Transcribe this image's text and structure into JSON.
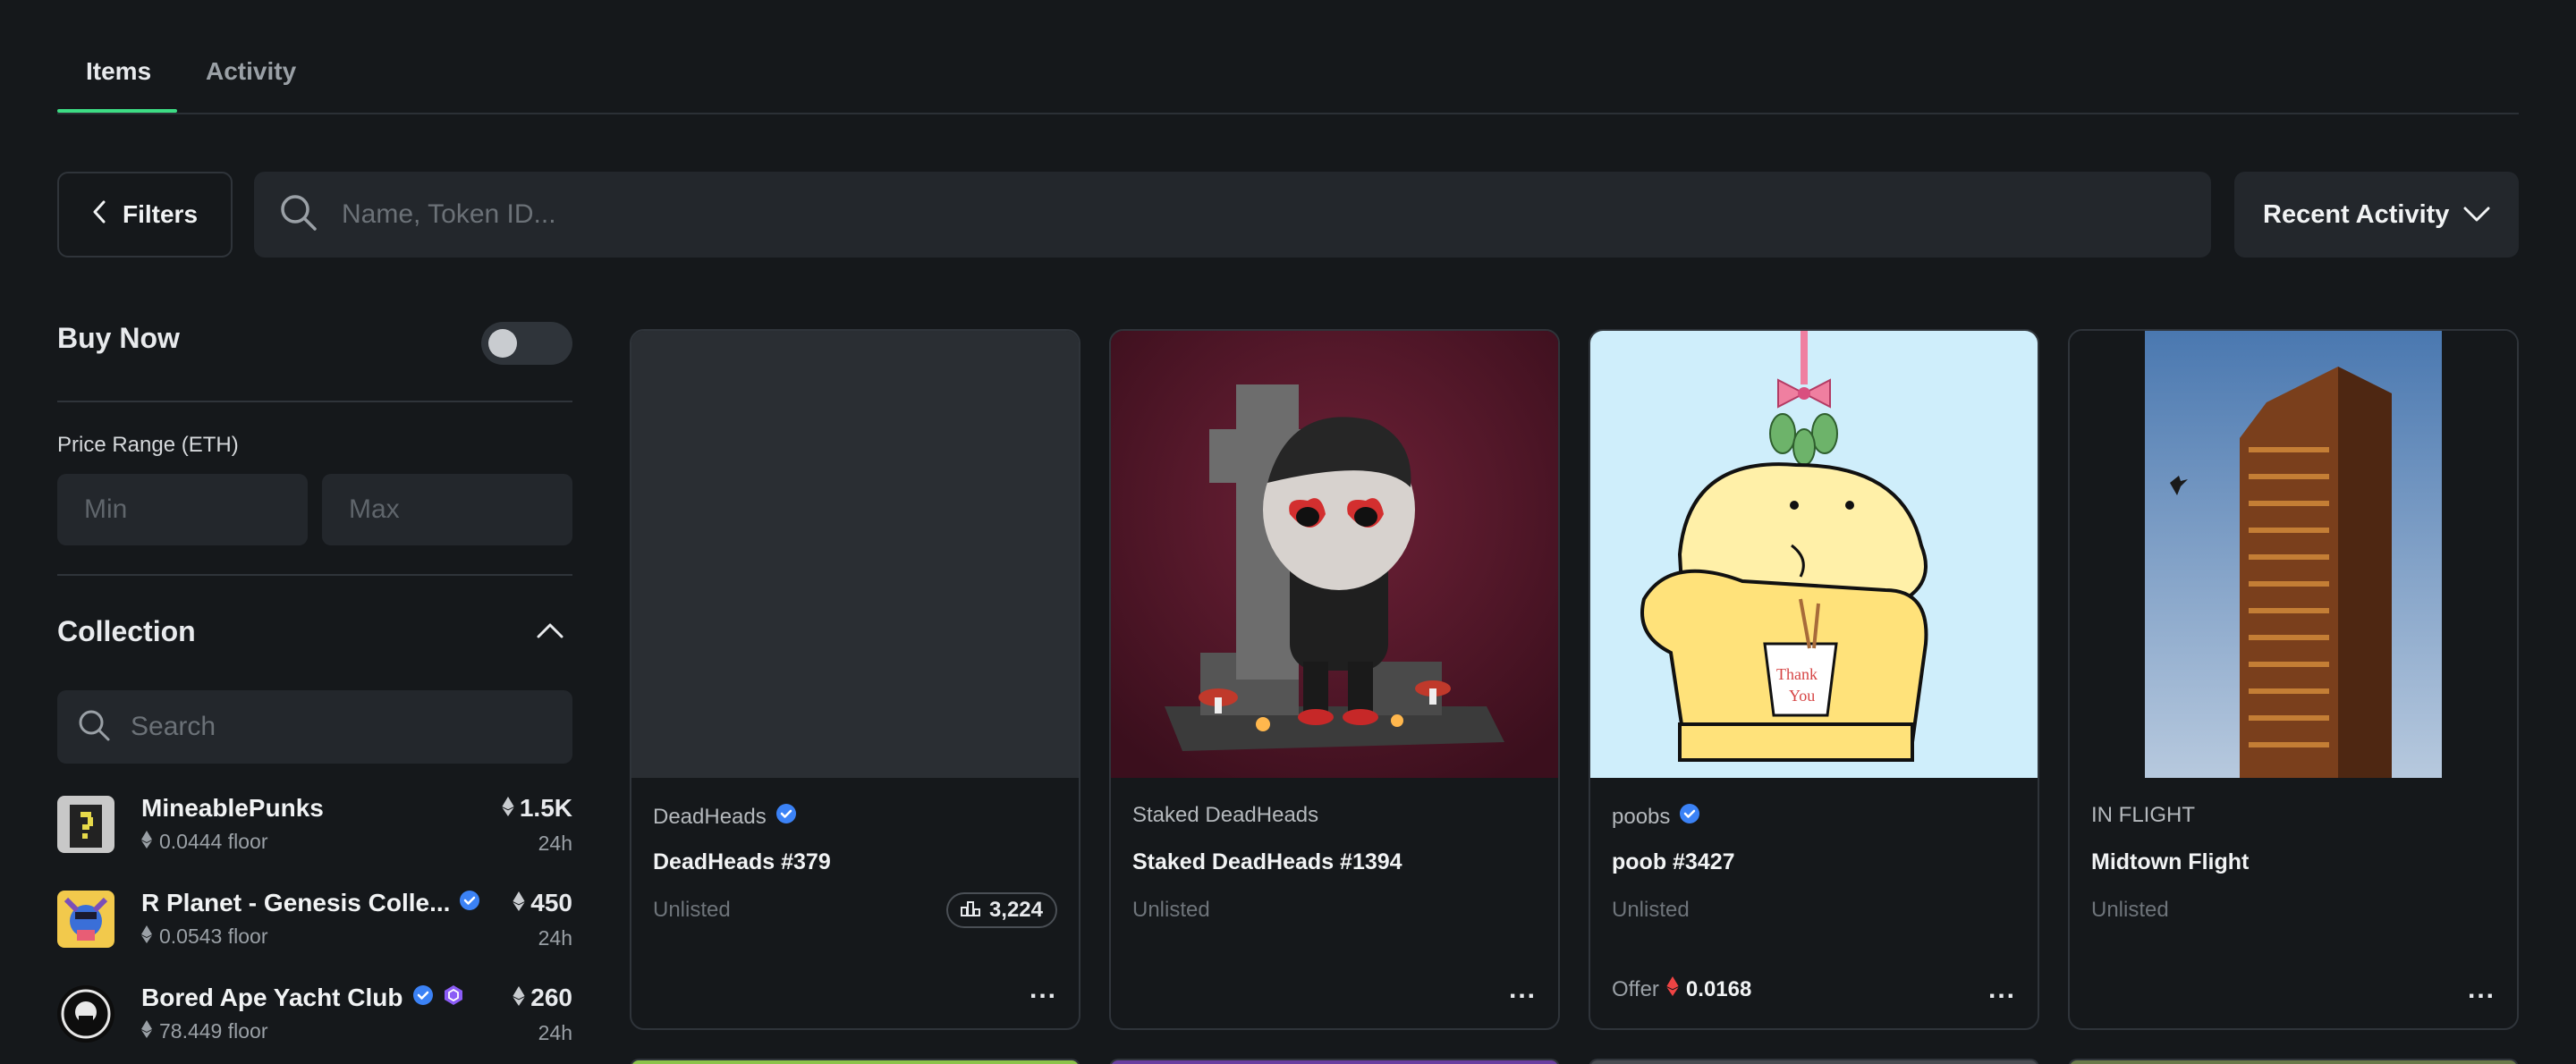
{
  "tabs": [
    {
      "label": "Items",
      "active": true
    },
    {
      "label": "Activity",
      "active": false
    }
  ],
  "toolbar": {
    "filters_label": "Filters",
    "search_placeholder": "Name, Token ID...",
    "sort_label": "Recent Activity"
  },
  "sidebar": {
    "buy_now_label": "Buy Now",
    "buy_now_enabled": false,
    "price_range_label": "Price Range (ETH)",
    "min_placeholder": "Min",
    "max_placeholder": "Max",
    "collection_title": "Collection",
    "collection_search_placeholder": "Search",
    "collections": [
      {
        "name": "MineablePunks",
        "floor": "0.0444 floor",
        "volume": "1.5K",
        "period": "24h",
        "verified": false
      },
      {
        "name": "R Planet - Genesis Colle...",
        "floor": "0.0543 floor",
        "volume": "450",
        "period": "24h",
        "verified": true
      },
      {
        "name": "Bored Ape Yacht Club",
        "floor": "78.449 floor",
        "volume": "260",
        "period": "24h",
        "verified": true
      }
    ]
  },
  "cards": [
    {
      "collection": "DeadHeads",
      "verified": true,
      "name": "DeadHeads #379",
      "status": "Unlisted",
      "badge": "3,224"
    },
    {
      "collection": "Staked DeadHeads",
      "verified": false,
      "name": "Staked DeadHeads #1394",
      "status": "Unlisted"
    },
    {
      "collection": "poobs",
      "verified": true,
      "name": "poob #3427",
      "status": "Unlisted",
      "offer_label": "Offer",
      "offer_amount": "0.0168"
    },
    {
      "collection": "IN FLIGHT",
      "verified": false,
      "name": "Midtown Flight",
      "status": "Unlisted"
    }
  ],
  "colors": {
    "accent_tab": "#3ddc84",
    "verified": "#3b82f6",
    "background": "#15181b",
    "surface": "#23272c"
  },
  "card_more_label": "..."
}
